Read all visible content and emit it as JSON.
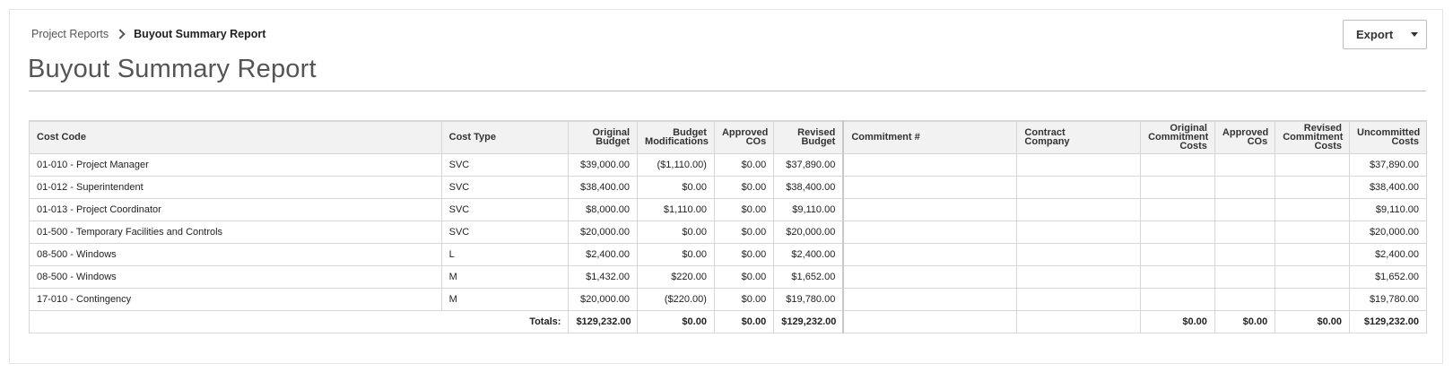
{
  "breadcrumb": {
    "parent": "Project Reports",
    "current": "Buyout Summary Report"
  },
  "title": "Buyout Summary Report",
  "export_label": "Export",
  "table": {
    "headers": {
      "cost_code": "Cost Code",
      "cost_type": "Cost Type",
      "original_budget": "Original\nBudget",
      "budget_mods": "Budget\nModifications",
      "approved_cos": "Approved\nCOs",
      "revised_budget": "Revised\nBudget",
      "commitment": "Commitment #",
      "contract_company": "Contract\nCompany",
      "orig_commit_costs": "Original\nCommitment\nCosts",
      "approved_cos_2": "Approved\nCOs",
      "revised_commit_costs": "Revised\nCommitment\nCosts",
      "uncommitted": "Uncommitted\nCosts"
    },
    "rows": [
      {
        "cost_code": "01-010 - Project Manager",
        "cost_type": "SVC",
        "original_budget": "$39,000.00",
        "budget_mods": "($1,110.00)",
        "approved_cos": "$0.00",
        "revised_budget": "$37,890.00",
        "commitment": "",
        "contract_company": "",
        "orig_commit_costs": "",
        "approved_cos_2": "",
        "revised_commit_costs": "",
        "uncommitted": "$37,890.00"
      },
      {
        "cost_code": "01-012 - Superintendent",
        "cost_type": "SVC",
        "original_budget": "$38,400.00",
        "budget_mods": "$0.00",
        "approved_cos": "$0.00",
        "revised_budget": "$38,400.00",
        "commitment": "",
        "contract_company": "",
        "orig_commit_costs": "",
        "approved_cos_2": "",
        "revised_commit_costs": "",
        "uncommitted": "$38,400.00"
      },
      {
        "cost_code": "01-013 - Project Coordinator",
        "cost_type": "SVC",
        "original_budget": "$8,000.00",
        "budget_mods": "$1,110.00",
        "approved_cos": "$0.00",
        "revised_budget": "$9,110.00",
        "commitment": "",
        "contract_company": "",
        "orig_commit_costs": "",
        "approved_cos_2": "",
        "revised_commit_costs": "",
        "uncommitted": "$9,110.00"
      },
      {
        "cost_code": "01-500 - Temporary Facilities and Controls",
        "cost_type": "SVC",
        "original_budget": "$20,000.00",
        "budget_mods": "$0.00",
        "approved_cos": "$0.00",
        "revised_budget": "$20,000.00",
        "commitment": "",
        "contract_company": "",
        "orig_commit_costs": "",
        "approved_cos_2": "",
        "revised_commit_costs": "",
        "uncommitted": "$20,000.00"
      },
      {
        "cost_code": "08-500 - Windows",
        "cost_type": "L",
        "original_budget": "$2,400.00",
        "budget_mods": "$0.00",
        "approved_cos": "$0.00",
        "revised_budget": "$2,400.00",
        "commitment": "",
        "contract_company": "",
        "orig_commit_costs": "",
        "approved_cos_2": "",
        "revised_commit_costs": "",
        "uncommitted": "$2,400.00"
      },
      {
        "cost_code": "08-500 - Windows",
        "cost_type": "M",
        "original_budget": "$1,432.00",
        "budget_mods": "$220.00",
        "approved_cos": "$0.00",
        "revised_budget": "$1,652.00",
        "commitment": "",
        "contract_company": "",
        "orig_commit_costs": "",
        "approved_cos_2": "",
        "revised_commit_costs": "",
        "uncommitted": "$1,652.00"
      },
      {
        "cost_code": "17-010 - Contingency",
        "cost_type": "M",
        "original_budget": "$20,000.00",
        "budget_mods": "($220.00)",
        "approved_cos": "$0.00",
        "revised_budget": "$19,780.00",
        "commitment": "",
        "contract_company": "",
        "orig_commit_costs": "",
        "approved_cos_2": "",
        "revised_commit_costs": "",
        "uncommitted": "$19,780.00"
      }
    ],
    "totals": {
      "label": "Totals:",
      "original_budget": "$129,232.00",
      "budget_mods": "$0.00",
      "approved_cos": "$0.00",
      "revised_budget": "$129,232.00",
      "commitment": "",
      "contract_company": "",
      "orig_commit_costs": "$0.00",
      "approved_cos_2": "$0.00",
      "revised_commit_costs": "$0.00",
      "uncommitted": "$129,232.00"
    }
  }
}
